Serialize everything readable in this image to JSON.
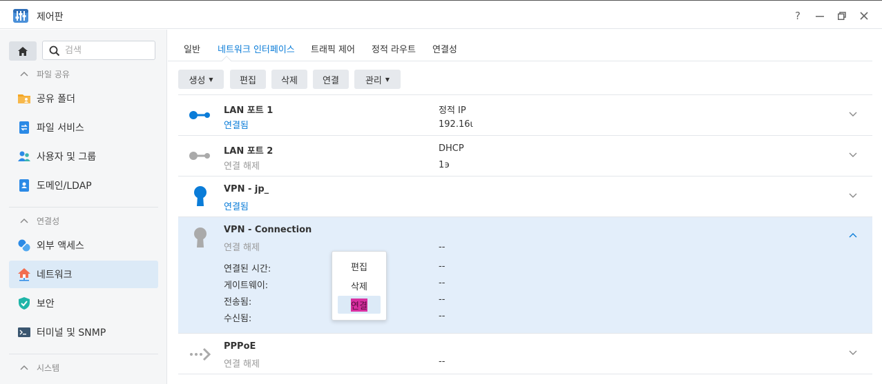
{
  "window": {
    "title": "제어판",
    "controls": {
      "help": "?",
      "minimize": "—",
      "restore": "❐",
      "close": "✕"
    }
  },
  "sidebar": {
    "search_placeholder": "검색",
    "sections": [
      {
        "label": "파일 공유",
        "items": [
          "공유 폴더",
          "파일 서비스",
          "사용자 및 그룹",
          "도메인/LDAP"
        ]
      },
      {
        "label": "연결성",
        "items": [
          "외부 액세스",
          "네트워크",
          "보안",
          "터미널 및 SNMP"
        ]
      },
      {
        "label": "시스템"
      }
    ],
    "active_item": "네트워크"
  },
  "tabs": [
    "일반",
    "네트워크 인터페이스",
    "트래픽 제어",
    "정적 라우트",
    "연결성"
  ],
  "active_tab": "네트워크 인터페이스",
  "toolbar": {
    "create": "생성",
    "edit": "편집",
    "delete": "삭제",
    "connect": "연결",
    "manage": "관리"
  },
  "interfaces": [
    {
      "name": "LAN 포트 1",
      "status": "연결됨",
      "v1": "정적 IP",
      "v2": "192.16ι",
      "icon": "lan-connected-icon"
    },
    {
      "name": "LAN 포트 2",
      "status": "연결 해제",
      "v1": "DHCP",
      "v2": "1϶",
      "icon": "lan-disconnected-icon"
    },
    {
      "name": "VPN - jp_",
      "status": "연결됨",
      "v1": "",
      "v2": "",
      "icon": "vpn-connected-icon"
    },
    {
      "name": "VPN - Connection",
      "status": "연결 해제",
      "v1": "",
      "v2": "--",
      "icon": "vpn-disconnected-icon",
      "details": [
        {
          "label": "연결된 시간:",
          "value": "--"
        },
        {
          "label": "게이트웨이:",
          "value": "--"
        },
        {
          "label": "전송됨:",
          "value": "--"
        },
        {
          "label": "수신됨:",
          "value": "--"
        }
      ]
    },
    {
      "name": "PPPoE",
      "status": "연결 해제",
      "v1": "",
      "v2": "--",
      "icon": "pppoe-icon"
    }
  ],
  "context_menu": [
    "편집",
    "삭제",
    "연결"
  ],
  "colors": {
    "accent": "#0a7cd8",
    "active_nav": "#dceaf7",
    "expanded_row": "#e3eefa",
    "highlight": "#d82fa0"
  }
}
